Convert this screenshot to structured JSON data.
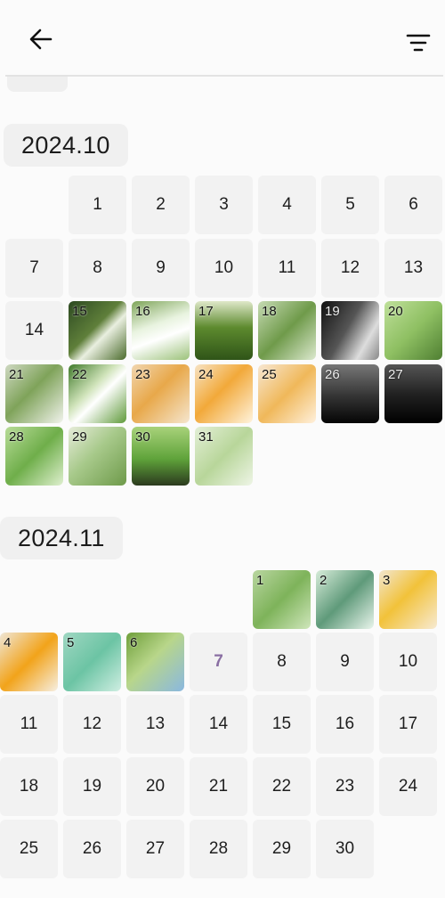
{
  "header": {
    "back_icon": "arrow-left-icon",
    "filter_icon": "filter-lines-icon"
  },
  "months": [
    {
      "label": "2024.10",
      "days": [
        {
          "day": "1"
        },
        {
          "day": "2"
        },
        {
          "day": "3"
        },
        {
          "day": "4"
        },
        {
          "day": "5"
        },
        {
          "day": "6"
        },
        {
          "day": "7"
        },
        {
          "day": "8"
        },
        {
          "day": "9"
        },
        {
          "day": "10"
        },
        {
          "day": "11"
        },
        {
          "day": "12"
        },
        {
          "day": "13"
        },
        {
          "day": "14"
        },
        {
          "day": "15",
          "photo": "linear-gradient(135deg,#2d4a22 0%,#5f7f3a 45%,#e9efe0 60%,#4b6b2c 100%)"
        },
        {
          "day": "16",
          "photo": "linear-gradient(160deg,#7fa55a 0%,#e8f3df 40%,#ffffff 60%,#9cc27a 100%)"
        },
        {
          "day": "17",
          "photo": "linear-gradient(180deg,#dfe8c9 0%,#5d8a2e 45%,#2f5418 100%)"
        },
        {
          "day": "18",
          "photo": "linear-gradient(135deg,#c6dbb3 0%,#6f9a4a 50%,#dce9cf 100%)"
        },
        {
          "day": "19",
          "photo": "linear-gradient(120deg,#111 0%,#555 45%,#ddd 75%,#888 100%)",
          "dark": true
        },
        {
          "day": "20",
          "photo": "linear-gradient(135deg,#bfe09a 0%,#8fc063 50%,#4f7f32 100%)"
        },
        {
          "day": "21",
          "photo": "linear-gradient(135deg,#cfd9c2 0%,#7fa35a 45%,#f1f3ec 100%)"
        },
        {
          "day": "22",
          "photo": "linear-gradient(135deg,#3f7a2a 0%,#cfe3b9 40%,#ffffff 55%,#5f9a3a 100%)"
        },
        {
          "day": "23",
          "photo": "linear-gradient(135deg,#f1d6b0 0%,#e8a84a 45%,#f5e6cf 100%)"
        },
        {
          "day": "24",
          "photo": "linear-gradient(135deg,#f7e3c4 0%,#f2a93a 45%,#fff3dd 100%)"
        },
        {
          "day": "25",
          "photo": "linear-gradient(135deg,#f7e7d2 0%,#f0b85a 50%,#fff0dc 100%)"
        },
        {
          "day": "26",
          "photo": "linear-gradient(180deg,#777 0%,#333 55%,#050505 100%)",
          "dark": true
        },
        {
          "day": "27",
          "photo": "linear-gradient(180deg,#555 0%,#222 50%,#000 100%)",
          "dark": true
        },
        {
          "day": "28",
          "photo": "linear-gradient(135deg,#b8dc98 0%,#6fae4a 50%,#dff0cf 100%)"
        },
        {
          "day": "29",
          "photo": "linear-gradient(135deg,#e6ecd9 0%,#a7c98a 45%,#6e9a4a 100%)"
        },
        {
          "day": "30",
          "photo": "linear-gradient(180deg,#a8d27a 0%,#5fa33a 55%,#2b3a1e 100%)"
        },
        {
          "day": "31",
          "photo": "linear-gradient(135deg,#e3efd6 0%,#b8d69a 50%,#eef5e6 100%)"
        }
      ]
    },
    {
      "label": "2024.11",
      "days": [
        {
          "day": "1",
          "photo": "linear-gradient(135deg,#b9d6a0 0%,#7eb35a 50%,#cfe6bb 100%)"
        },
        {
          "day": "2",
          "photo": "linear-gradient(135deg,#d7ecd9 0%,#5f9a7a 50%,#e9f5ec 100%)"
        },
        {
          "day": "3",
          "photo": "linear-gradient(135deg,#f2e6cf 0%,#f2c23a 45%,#f7ead2 100%)"
        },
        {
          "day": "4",
          "photo": "linear-gradient(135deg,#efe6d6 0%,#f2a31a 50%,#f6efe2 100%)"
        },
        {
          "day": "5",
          "photo": "linear-gradient(135deg,#9fd7c2 0%,#6cc4a4 50%,#cfeee2 100%)"
        },
        {
          "day": "6",
          "photo": "linear-gradient(135deg,#6f9f3a 0%,#b8d68a 45%,#8ab8e0 100%)"
        },
        {
          "day": "7",
          "today": true
        },
        {
          "day": "8"
        },
        {
          "day": "9"
        },
        {
          "day": "10"
        },
        {
          "day": "11"
        },
        {
          "day": "12"
        },
        {
          "day": "13"
        },
        {
          "day": "14"
        },
        {
          "day": "15"
        },
        {
          "day": "16"
        },
        {
          "day": "17"
        },
        {
          "day": "18"
        },
        {
          "day": "19"
        },
        {
          "day": "20"
        },
        {
          "day": "21"
        },
        {
          "day": "22"
        },
        {
          "day": "23"
        },
        {
          "day": "24"
        },
        {
          "day": "25"
        },
        {
          "day": "26"
        },
        {
          "day": "27"
        },
        {
          "day": "28"
        },
        {
          "day": "29"
        },
        {
          "day": "30"
        }
      ]
    }
  ]
}
